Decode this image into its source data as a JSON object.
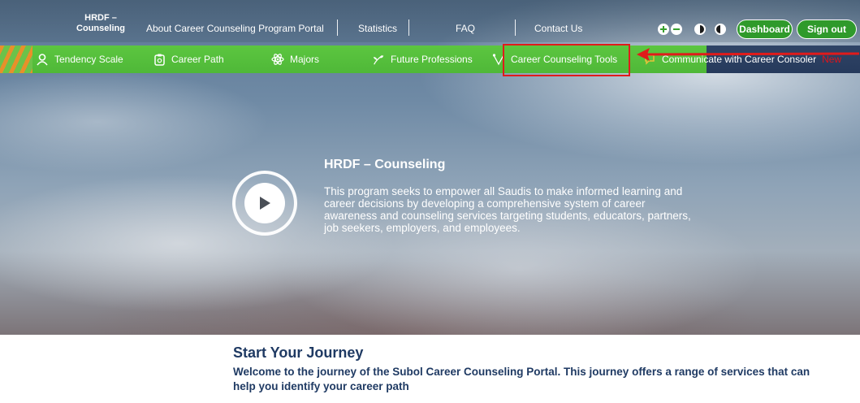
{
  "header": {
    "brand": "HRDF –\nCounseling",
    "links": [
      {
        "label": "About  Career Counseling Program Portal"
      },
      {
        "label": "Statistics"
      },
      {
        "label": "FAQ"
      },
      {
        "label": "Contact Us"
      }
    ],
    "accessibility": [
      "zoom-in-icon",
      "zoom-out-icon",
      "contrast-icon",
      "contrast-invert-icon"
    ],
    "dashboard_label": "Dashboard",
    "signout_label": "Sign out"
  },
  "nav": {
    "items": [
      {
        "label": "Tendency Scale",
        "icon": "person-icon"
      },
      {
        "label": "Career Path",
        "icon": "clipboard-icon"
      },
      {
        "label": "Majors",
        "icon": "atom-icon"
      },
      {
        "label": "Future Professions",
        "icon": "plant-icon"
      },
      {
        "label": "Career Counseling  Tools",
        "icon": "tools-icon"
      },
      {
        "label": "Communicate with Career Consoler",
        "icon": "chat-icon"
      }
    ],
    "new_badge": "New"
  },
  "hero": {
    "title": "HRDF – Counseling",
    "description": "This program seeks to empower all Saudis to make informed learning and career decisions by developing a comprehensive system of career awareness and counseling services targeting students, educators, partners, job seekers, employers, and employees."
  },
  "journey": {
    "title": "Start Your Journey",
    "description": "Welcome to the journey of the Subol Career Counseling Portal. This journey offers a range of services that can help you identify your career path"
  },
  "colors": {
    "nav_green": "#55be3c",
    "button_green": "#2f9a2b",
    "highlight_red": "#e01b1b",
    "text_navy": "#1f3a63"
  }
}
